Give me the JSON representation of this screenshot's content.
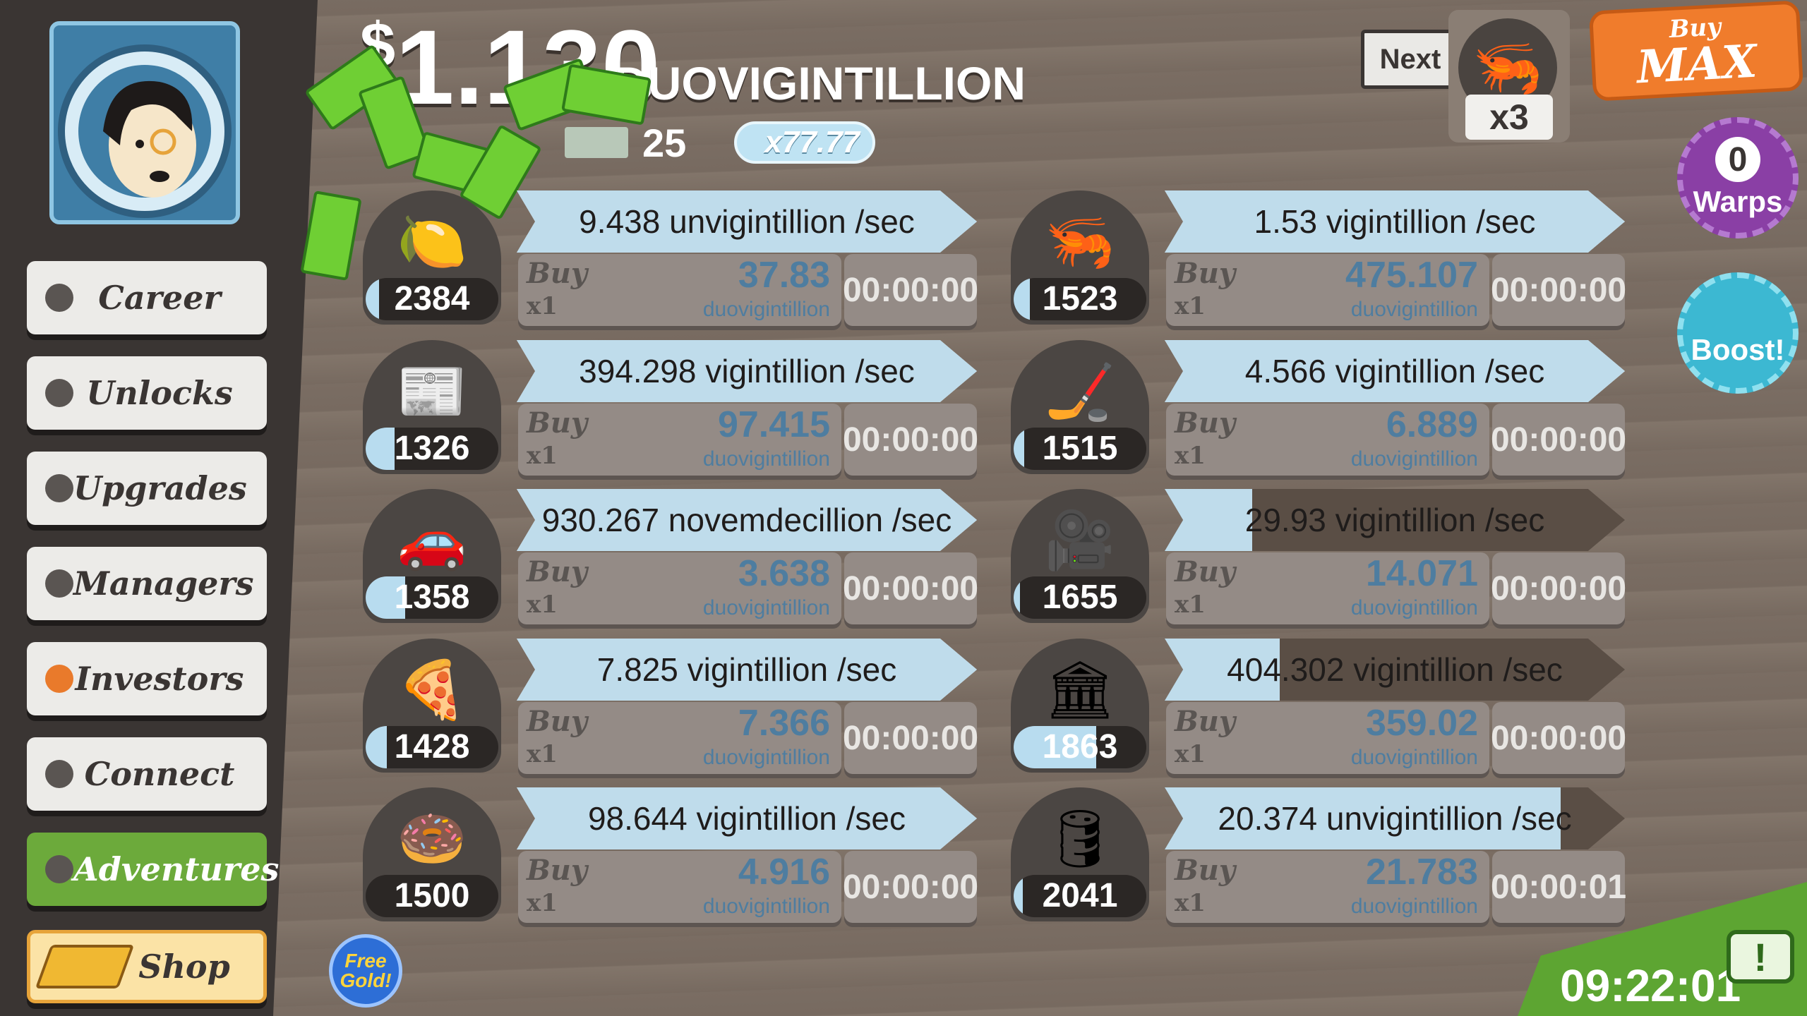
{
  "header": {
    "cash_symbol": "$",
    "cash_value": "1.130",
    "cash_unit": "DUOVIGINTILLION",
    "angel_count": "25",
    "multiplier": "x77.77"
  },
  "sidebar": {
    "items": [
      {
        "label": "Career",
        "dot": "#5a5552"
      },
      {
        "label": "Unlocks",
        "dot": "#5a5552"
      },
      {
        "label": "Upgrades",
        "dot": "#5a5552"
      },
      {
        "label": "Managers",
        "dot": "#5a5552"
      },
      {
        "label": "Investors",
        "dot": "#e97a2b"
      },
      {
        "label": "Connect",
        "dot": "#5a5552"
      },
      {
        "label": "Adventures",
        "dot": "#5a5552"
      },
      {
        "label": "Shop",
        "dot": ""
      }
    ]
  },
  "top_right": {
    "next_label": "Next",
    "next_multiplier": "x3",
    "buy_label": "Buy",
    "max_label": "MAX",
    "warps_count": "0",
    "warps_label": "Warps",
    "boost_label": "Boost!"
  },
  "free_gold_label": "Free Gold!",
  "timer": "09:22:01",
  "buy_word": "Buy",
  "buy_qty": "x1",
  "businesses": [
    {
      "icon": "lemon-icon",
      "count": "2384",
      "count_fill": 0.1,
      "rate": "9.438 unvigintillion /sec",
      "progress": 1.0,
      "cost": "37.83",
      "cost_unit": "duovigintillion",
      "time": "00:00:00"
    },
    {
      "icon": "shrimp-icon",
      "count": "1523",
      "count_fill": 0.12,
      "rate": "1.53 vigintillion /sec",
      "progress": 1.0,
      "cost": "475.107",
      "cost_unit": "duovigintillion",
      "time": "00:00:00"
    },
    {
      "icon": "newspaper-icon",
      "count": "1326",
      "count_fill": 0.22,
      "rate": "394.298 vigintillion /sec",
      "progress": 1.0,
      "cost": "97.415",
      "cost_unit": "duovigintillion",
      "time": "00:00:00"
    },
    {
      "icon": "hockey-icon",
      "count": "1515",
      "count_fill": 0.08,
      "rate": "4.566 vigintillion /sec",
      "progress": 1.0,
      "cost": "6.889",
      "cost_unit": "duovigintillion",
      "time": "00:00:00"
    },
    {
      "icon": "car-wash-icon",
      "count": "1358",
      "count_fill": 0.3,
      "rate": "930.267 novemdecillion /sec",
      "progress": 1.0,
      "cost": "3.638",
      "cost_unit": "duovigintillion",
      "time": "00:00:00"
    },
    {
      "icon": "movie-camera-icon",
      "count": "1655",
      "count_fill": 0.05,
      "rate": "29.93 vigintillion /sec",
      "progress": 0.19,
      "cost": "14.071",
      "cost_unit": "duovigintillion",
      "time": "00:00:00"
    },
    {
      "icon": "pizza-icon",
      "count": "1428",
      "count_fill": 0.16,
      "rate": "7.825 vigintillion /sec",
      "progress": 1.0,
      "cost": "7.366",
      "cost_unit": "duovigintillion",
      "time": "00:00:00"
    },
    {
      "icon": "bank-icon",
      "count": "1863",
      "count_fill": 0.62,
      "rate": "404.302 vigintillion /sec",
      "progress": 0.25,
      "cost": "359.02",
      "cost_unit": "duovigintillion",
      "time": "00:00:00"
    },
    {
      "icon": "donut-icon",
      "count": "1500",
      "count_fill": 0.0,
      "rate": "98.644 vigintillion /sec",
      "progress": 1.0,
      "cost": "4.916",
      "cost_unit": "duovigintillion",
      "time": "00:00:00"
    },
    {
      "icon": "oil-rig-icon",
      "count": "2041",
      "count_fill": 0.07,
      "rate": "20.374 unvigintillion /sec",
      "progress": 0.86,
      "cost": "21.783",
      "cost_unit": "duovigintillion",
      "time": "00:00:01"
    }
  ]
}
